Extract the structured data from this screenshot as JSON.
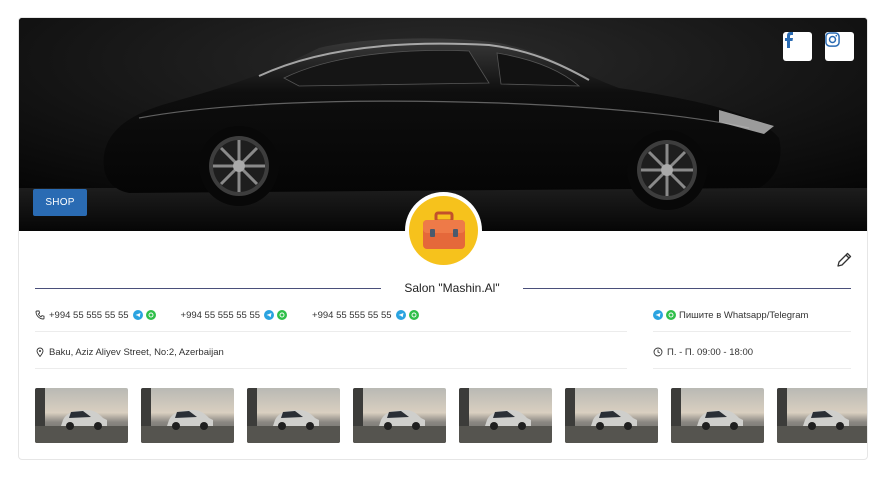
{
  "banner": {
    "shop_label": "SHOP",
    "social": [
      {
        "name": "facebook",
        "icon": "facebook-icon"
      },
      {
        "name": "instagram",
        "icon": "instagram-icon"
      }
    ]
  },
  "profile": {
    "title": "Salon \"Mashin.Al\"",
    "avatar_icon": "briefcase-icon"
  },
  "contacts": {
    "phones": [
      {
        "number": "+994 55 555 55 55"
      },
      {
        "number": "+994 55 555 55 55"
      },
      {
        "number": "+994 55 555 55 55"
      }
    ],
    "message_note": "Пишите в Whatsapp/Telegram",
    "address": "Baku, Aziz Aliyev Street, No:2, Azerbaijan",
    "hours": "П. - П. 09:00 - 18:00"
  },
  "gallery_count": 8,
  "colors": {
    "accent": "#2a6bb3",
    "telegram": "#2aa3e0",
    "whatsapp": "#2fbf4a",
    "avatar_bg": "#f6c21c",
    "briefcase": "#e5683a"
  }
}
